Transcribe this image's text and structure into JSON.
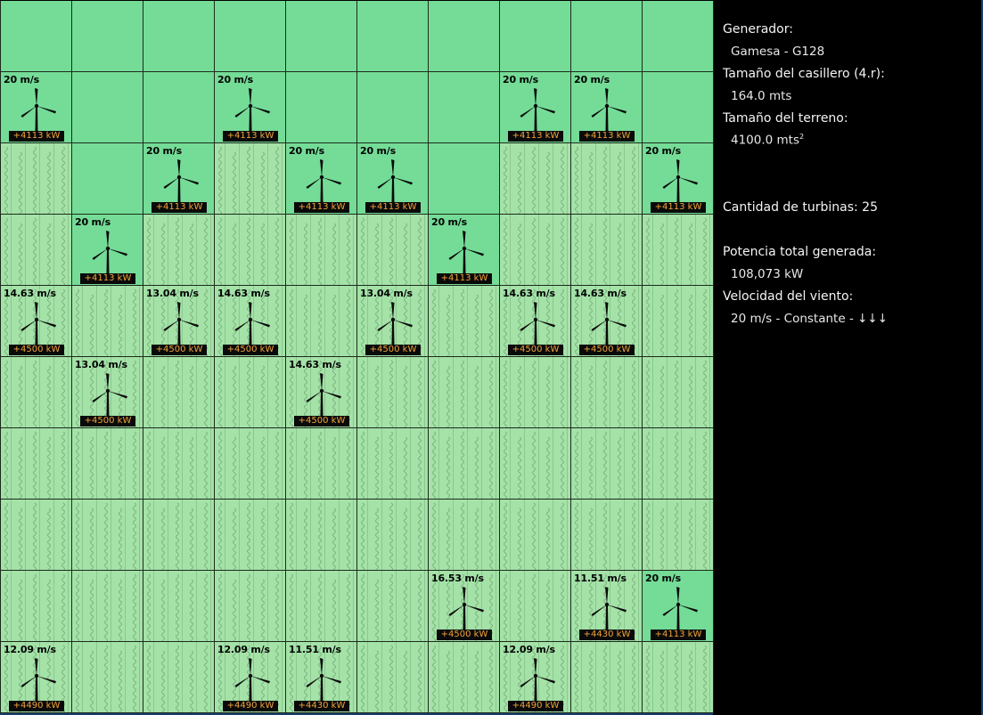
{
  "panel": {
    "generator_label": "Generador:",
    "generator_value": "Gamesa - G128",
    "cell_size_label": "Tamaño del casillero (4.r):",
    "cell_size_value": "164.0 mts",
    "terrain_size_label": "Tamaño del terreno:",
    "terrain_size_value": "4100.0 mts",
    "terrain_size_unit_sup": "2",
    "turbine_count_label": "Cantidad de turbinas: 25",
    "total_power_label": "Potencia total generada:",
    "total_power_value": "108,073 kW",
    "wind_label": "Velocidad del viento:",
    "wind_value": "20 m/s - Constante - ↓↓↓"
  },
  "colors": {
    "grass_dark": "#74dc97",
    "grass_light": "#a4e2a8",
    "power_text": "#f0a43a",
    "panel_bg": "#000000"
  },
  "grid": {
    "rows": [
      [
        {
          "t": "dark"
        },
        {
          "t": "dark"
        },
        {
          "t": "dark"
        },
        {
          "t": "dark"
        },
        {
          "t": "dark"
        },
        {
          "t": "dark"
        },
        {
          "t": "dark"
        },
        {
          "t": "dark"
        },
        {
          "t": "dark"
        },
        {
          "t": "dark"
        }
      ],
      [
        {
          "t": "dark",
          "speed": "20 m/s",
          "power": "+4113 kW"
        },
        {
          "t": "dark"
        },
        {
          "t": "dark"
        },
        {
          "t": "dark",
          "speed": "20 m/s",
          "power": "+4113 kW"
        },
        {
          "t": "dark"
        },
        {
          "t": "dark"
        },
        {
          "t": "dark"
        },
        {
          "t": "dark",
          "speed": "20 m/s",
          "power": "+4113 kW"
        },
        {
          "t": "dark",
          "speed": "20 m/s",
          "power": "+4113 kW"
        },
        {
          "t": "dark"
        }
      ],
      [
        {
          "t": "light"
        },
        {
          "t": "dark"
        },
        {
          "t": "dark",
          "speed": "20 m/s",
          "power": "+4113 kW"
        },
        {
          "t": "light"
        },
        {
          "t": "dark",
          "speed": "20 m/s",
          "power": "+4113 kW"
        },
        {
          "t": "dark",
          "speed": "20 m/s",
          "power": "+4113 kW"
        },
        {
          "t": "dark"
        },
        {
          "t": "light"
        },
        {
          "t": "light"
        },
        {
          "t": "dark",
          "speed": "20 m/s",
          "power": "+4113 kW"
        }
      ],
      [
        {
          "t": "light"
        },
        {
          "t": "dark",
          "speed": "20 m/s",
          "power": "+4113 kW"
        },
        {
          "t": "light"
        },
        {
          "t": "light"
        },
        {
          "t": "light"
        },
        {
          "t": "light"
        },
        {
          "t": "dark",
          "speed": "20 m/s",
          "power": "+4113 kW"
        },
        {
          "t": "light"
        },
        {
          "t": "light"
        },
        {
          "t": "light"
        }
      ],
      [
        {
          "t": "light",
          "speed": "14.63 m/s",
          "power": "+4500 kW"
        },
        {
          "t": "light"
        },
        {
          "t": "light",
          "speed": "13.04 m/s",
          "power": "+4500 kW"
        },
        {
          "t": "light",
          "speed": "14.63 m/s",
          "power": "+4500 kW"
        },
        {
          "t": "light"
        },
        {
          "t": "light",
          "speed": "13.04 m/s",
          "power": "+4500 kW"
        },
        {
          "t": "light"
        },
        {
          "t": "light",
          "speed": "14.63 m/s",
          "power": "+4500 kW"
        },
        {
          "t": "light",
          "speed": "14.63 m/s",
          "power": "+4500 kW"
        },
        {
          "t": "light"
        }
      ],
      [
        {
          "t": "light"
        },
        {
          "t": "light",
          "speed": "13.04 m/s",
          "power": "+4500 kW"
        },
        {
          "t": "light"
        },
        {
          "t": "light"
        },
        {
          "t": "light",
          "speed": "14.63 m/s",
          "power": "+4500 kW"
        },
        {
          "t": "light"
        },
        {
          "t": "light"
        },
        {
          "t": "light"
        },
        {
          "t": "light"
        },
        {
          "t": "light"
        }
      ],
      [
        {
          "t": "light"
        },
        {
          "t": "light"
        },
        {
          "t": "light"
        },
        {
          "t": "light"
        },
        {
          "t": "light"
        },
        {
          "t": "light"
        },
        {
          "t": "light"
        },
        {
          "t": "light"
        },
        {
          "t": "light"
        },
        {
          "t": "light"
        }
      ],
      [
        {
          "t": "light"
        },
        {
          "t": "light"
        },
        {
          "t": "light"
        },
        {
          "t": "light"
        },
        {
          "t": "light"
        },
        {
          "t": "light"
        },
        {
          "t": "light"
        },
        {
          "t": "light"
        },
        {
          "t": "light"
        },
        {
          "t": "light"
        }
      ],
      [
        {
          "t": "light"
        },
        {
          "t": "light"
        },
        {
          "t": "light"
        },
        {
          "t": "light"
        },
        {
          "t": "light"
        },
        {
          "t": "light"
        },
        {
          "t": "light",
          "speed": "16.53 m/s",
          "power": "+4500 kW"
        },
        {
          "t": "light"
        },
        {
          "t": "light",
          "speed": "11.51 m/s",
          "power": "+4430 kW"
        },
        {
          "t": "dark",
          "speed": "20 m/s",
          "power": "+4113 kW"
        }
      ],
      [
        {
          "t": "light",
          "speed": "12.09 m/s",
          "power": "+4490 kW"
        },
        {
          "t": "light"
        },
        {
          "t": "light"
        },
        {
          "t": "light",
          "speed": "12.09 m/s",
          "power": "+4490 kW"
        },
        {
          "t": "light",
          "speed": "11.51 m/s",
          "power": "+4430 kW"
        },
        {
          "t": "light"
        },
        {
          "t": "light"
        },
        {
          "t": "light",
          "speed": "12.09 m/s",
          "power": "+4490 kW"
        },
        {
          "t": "light"
        },
        {
          "t": "light"
        }
      ]
    ]
  }
}
